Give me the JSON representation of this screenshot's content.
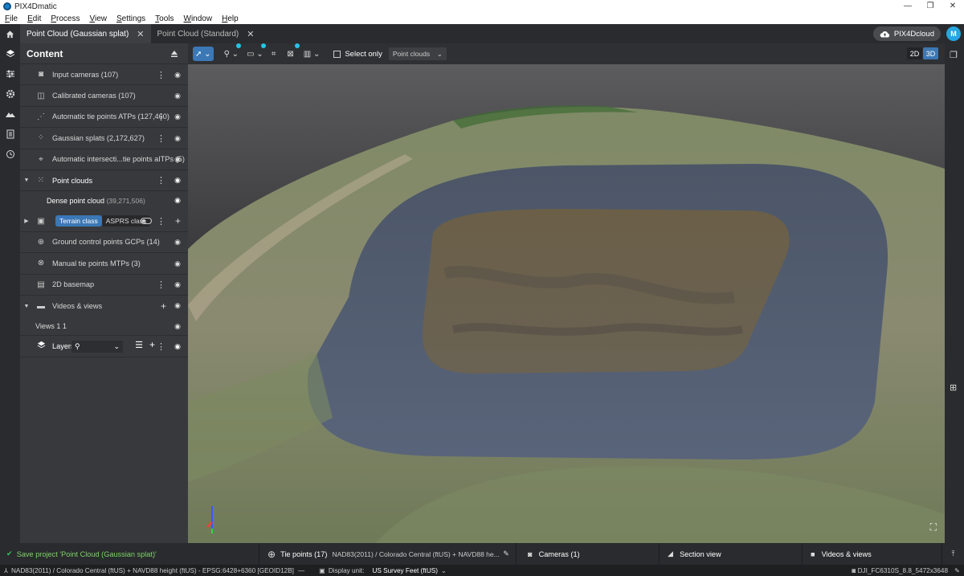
{
  "window": {
    "title": "PIX4Dmatic",
    "minimize": "—",
    "maximize": "❐",
    "close": "✕"
  },
  "menu": [
    "File",
    "Edit",
    "Process",
    "View",
    "Settings",
    "Tools",
    "Window",
    "Help"
  ],
  "tabs": [
    {
      "label": "Point Cloud (Gaussian splat)",
      "active": true
    },
    {
      "label": "Point Cloud (Standard)",
      "active": false
    }
  ],
  "cloud_button": "PIX4Dcloud",
  "avatar_initial": "M",
  "content_panel": {
    "title": "Content",
    "items": [
      {
        "label": "Input cameras (107)"
      },
      {
        "label": "Calibrated cameras (107)"
      },
      {
        "label": "Automatic tie points ATPs (127,460)"
      },
      {
        "label": "Gaussian splats (2,172,627)"
      },
      {
        "label": "Automatic intersecti...tie points aITPs (5)"
      },
      {
        "label": "Point clouds"
      },
      {
        "label": "Dense point cloud",
        "count": "(39,271,506)"
      },
      {
        "label": "Terrain class",
        "label2": "ASPRS class"
      },
      {
        "label": "Ground control points GCPs (14)"
      },
      {
        "label": "Manual tie points MTPs (3)"
      },
      {
        "label": "2D basemap"
      },
      {
        "label": "Videos & views"
      },
      {
        "label": "Views 1 1"
      },
      {
        "label": "Layers"
      }
    ]
  },
  "toolbar": {
    "select_only": "Select only",
    "dropdown": "Point clouds",
    "mode_2d": "2D",
    "mode_3d": "3D"
  },
  "bottom_tabs": {
    "save": "Save project 'Point Cloud (Gaussian splat)'",
    "tie_points": "Tie points (17)",
    "tie_points_crs": "NAD83(2011) / Colorado Central (ftUS) + NAVD88 he...",
    "cameras": "Cameras (1)",
    "section_view": "Section view",
    "videos_views": "Videos & views"
  },
  "status": {
    "crs": "NAD83(2011) / Colorado Central (ftUS) + NAVD88 height (ftUS) - EPSG:6428+6360 [GEOID12B]",
    "display_unit_label": "Display unit:",
    "display_unit": "US Survey Feet (ftUS)",
    "camera": "DJI_FC6310S_8.8_5472x3648"
  }
}
